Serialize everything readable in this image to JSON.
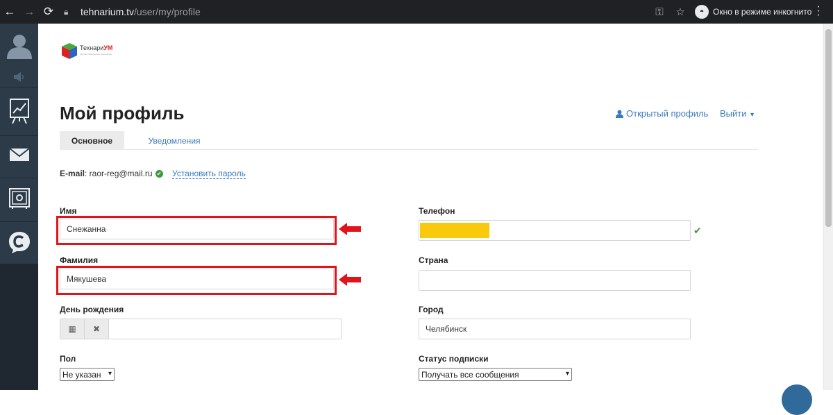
{
  "browser": {
    "url_host": "tehnarium.tv",
    "url_path": "/user/my/profile",
    "incognito_label": "Окно в режиме инкогнито"
  },
  "logo": {
    "text_main": "Технари",
    "text_accent": "УМ",
    "tagline": "Портал технического творчества"
  },
  "page": {
    "title": "Мой профиль",
    "profile_link": "Открытый профиль",
    "logout_link": "Выйти"
  },
  "tabs": [
    {
      "label": "Основное",
      "active": true
    },
    {
      "label": "Уведомления",
      "active": false
    }
  ],
  "account": {
    "email_label": "E-mail",
    "email_value": ": raor-reg@mail.ru",
    "set_password_label": "Установить пароль"
  },
  "form": {
    "first_name": {
      "label": "Имя",
      "value": "Снежанна"
    },
    "last_name": {
      "label": "Фамилия",
      "value": "Мякушева"
    },
    "birthday": {
      "label": "День рождения",
      "value": ""
    },
    "gender": {
      "label": "Пол",
      "value": "Не указан"
    },
    "phone": {
      "label": "Телефон",
      "value": ""
    },
    "country": {
      "label": "Страна",
      "value": ""
    },
    "city": {
      "label": "Город",
      "value": "Челябинск"
    },
    "subscription": {
      "label": "Статус подписки",
      "value": "Получать все сообщения"
    }
  },
  "colors": {
    "sidebar": "#2d3a48",
    "link": "#3b7abf",
    "highlight": "#e0141b",
    "verified": "#3c9a3c",
    "phone_mask": "#f9c90d"
  }
}
